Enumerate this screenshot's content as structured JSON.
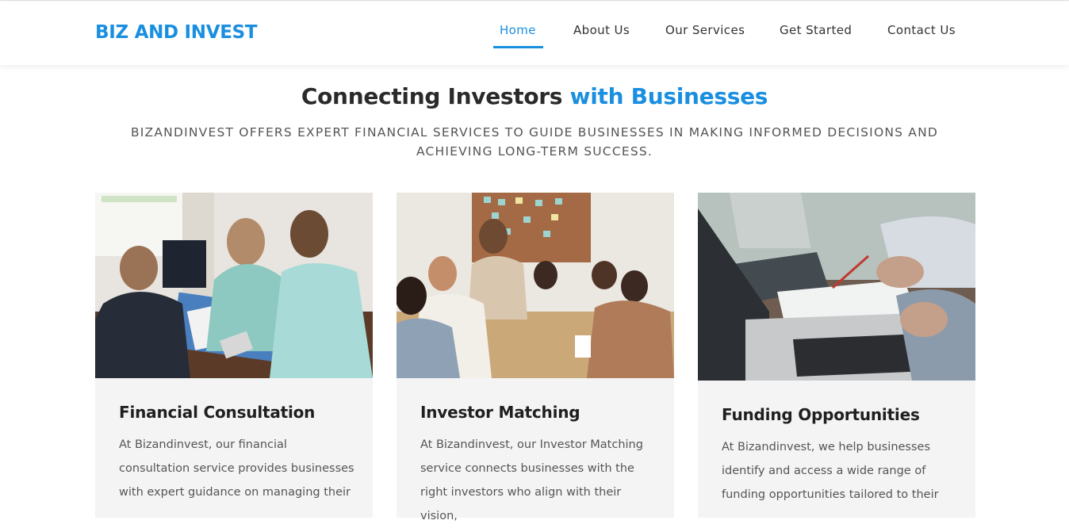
{
  "header": {
    "logo": "BIZ AND INVEST",
    "nav": [
      {
        "label": "Home",
        "active": true
      },
      {
        "label": "About Us"
      },
      {
        "label": "Our Services"
      },
      {
        "label": "Get Started"
      },
      {
        "label": "Contact Us"
      }
    ]
  },
  "hero": {
    "title_part1": "Connecting Investors ",
    "title_part2": "with Businesses",
    "subtitle": "BIZANDINVEST OFFERS EXPERT FINANCIAL SERVICES TO GUIDE BUSINESSES IN MAKING INFORMED DECISIONS AND ACHIEVING LONG-TERM SUCCESS."
  },
  "cards": [
    {
      "title": "Financial Consultation",
      "text": "At Bizandinvest, our financial consultation service provides businesses with expert guidance on managing their"
    },
    {
      "title": "Investor Matching",
      "text": "At Bizandinvest, our Investor Matching service connects businesses with the right investors who align with their vision,"
    },
    {
      "title": "Funding Opportunities",
      "text": "At Bizandinvest, we help businesses identify and access a wide range of funding opportunities tailored to their"
    }
  ],
  "colors": {
    "accent": "#1a8fe0",
    "card_bg": "#f4f4f4",
    "heading": "#2a2a2a"
  }
}
